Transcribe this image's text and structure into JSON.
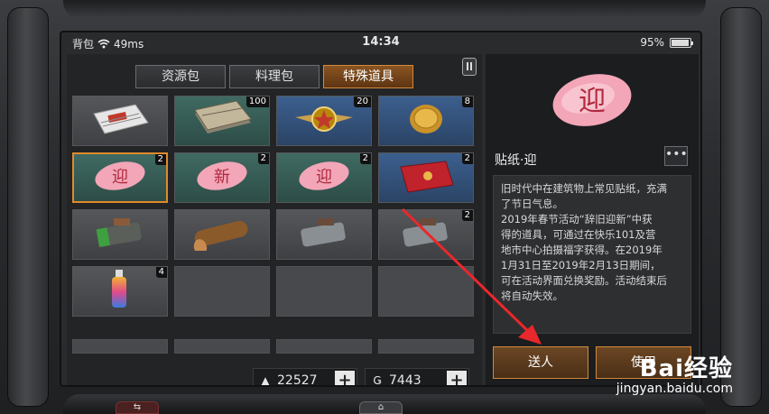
{
  "status_bar": {
    "left_label": "背包",
    "ping": "49ms",
    "time": "14:34",
    "battery": "95%",
    "battery_level": 0.95
  },
  "tabs": [
    {
      "label": "资源包",
      "active": false
    },
    {
      "label": "料理包",
      "active": false
    },
    {
      "label": "特殊道具",
      "active": true
    }
  ],
  "items": [
    {
      "name": "newspaper",
      "count": "",
      "bg": "grey"
    },
    {
      "name": "envelopes-stack",
      "count": "100",
      "bg": "green"
    },
    {
      "name": "winged-badge",
      "count": "20",
      "bg": "blue"
    },
    {
      "name": "gold-coin",
      "count": "8",
      "bg": "blue"
    },
    {
      "name": "sticker-ying",
      "count": "2",
      "bg": "green",
      "selected": true
    },
    {
      "name": "sticker-xin",
      "count": "2",
      "bg": "green"
    },
    {
      "name": "sticker-ying-2",
      "count": "2",
      "bg": "green"
    },
    {
      "name": "red-envelope",
      "count": "2",
      "bg": "blue"
    },
    {
      "name": "battery-canister",
      "count": "",
      "bg": "grey"
    },
    {
      "name": "wood-log",
      "count": "",
      "bg": "grey"
    },
    {
      "name": "metal-canister",
      "count": "",
      "bg": "grey"
    },
    {
      "name": "metal-canister-2",
      "count": "2",
      "bg": "grey"
    },
    {
      "name": "spray-bottle",
      "count": "4",
      "bg": "grey"
    },
    {
      "name": "",
      "count": "",
      "bg": "empty"
    },
    {
      "name": "",
      "count": "",
      "bg": "empty"
    },
    {
      "name": "",
      "count": "",
      "bg": "empty"
    }
  ],
  "currency": {
    "primary_value": "22527",
    "secondary_value": "7443",
    "plus": "+"
  },
  "detail": {
    "title": "贴纸·迎",
    "more": "•••",
    "desc_lines": [
      "旧时代中在建筑物上常见贴纸，充满",
      "了节日气息。",
      "2019年春节活动“辞旧迎新”中获",
      "得的道具，可通过在快乐101及营",
      "地市中心拍摄福字获得。在2019年",
      "1月31日至2019年2月13日期间，",
      "可在活动界面兑换奖励。活动结束后",
      "将自动失效。"
    ],
    "send_label": "送人",
    "use_label": "使用"
  },
  "watermark": {
    "logo": "Bai经验",
    "url": "jingyan.baidu.com"
  },
  "colors": {
    "accent": "#e08a2a",
    "annotation_arrow": "#e8282c"
  }
}
